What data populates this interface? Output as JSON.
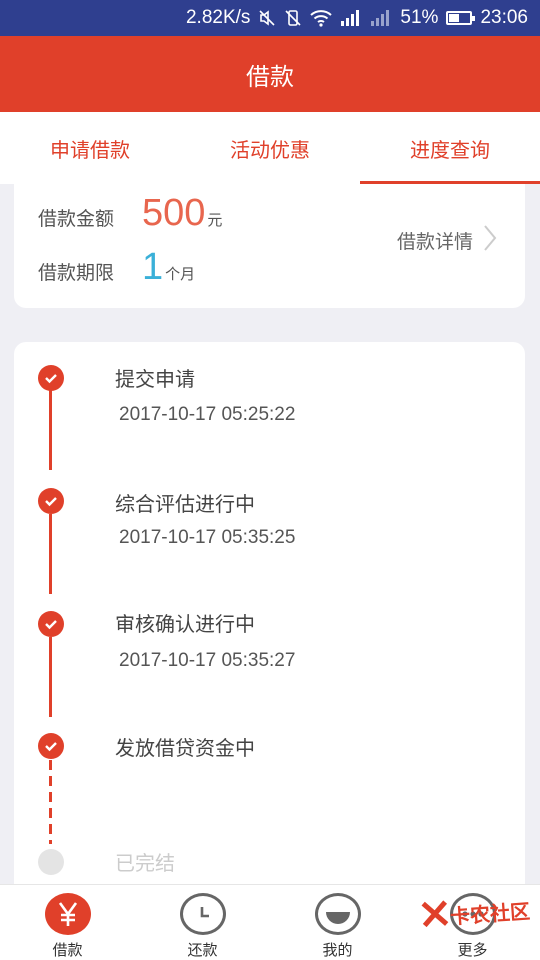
{
  "status_bar": {
    "speed": "2.82K/s",
    "battery": "51%",
    "battery_level": 0.51,
    "time": "23:06"
  },
  "header": {
    "title": "借款"
  },
  "tabs": [
    {
      "label": "申请借款",
      "active": false
    },
    {
      "label": "活动优惠",
      "active": false
    },
    {
      "label": "进度查询",
      "active": true
    }
  ],
  "summary": {
    "amount_label": "借款金额",
    "amount_value": "500",
    "amount_unit": "元",
    "term_label": "借款期限",
    "term_value": "1",
    "term_unit": "个月",
    "detail_link": "借款详情"
  },
  "timeline": {
    "steps": [
      {
        "title": "提交申请",
        "time": "2017-10-17 05:25:22",
        "status": "done"
      },
      {
        "title": "综合评估进行中",
        "time": "2017-10-17 05:35:25",
        "status": "done"
      },
      {
        "title": "审核确认进行中",
        "time": "2017-10-17 05:35:27",
        "status": "done"
      },
      {
        "title": "发放借贷资金中",
        "time": "",
        "status": "done"
      },
      {
        "title": "已完结",
        "time": "",
        "status": "pending"
      }
    ]
  },
  "bottom_nav": [
    {
      "label": "借款",
      "icon": "yen-icon",
      "active": true
    },
    {
      "label": "还款",
      "icon": "clock-icon",
      "active": false
    },
    {
      "label": "我的",
      "icon": "user-icon",
      "active": false
    },
    {
      "label": "更多",
      "icon": "more-icon",
      "active": false
    }
  ],
  "watermark": {
    "text": "卡农社区"
  },
  "colors": {
    "brand": "#e0402a",
    "status_bar": "#2f3f8f",
    "term": "#3ab0d8",
    "amount": "#e8664e"
  }
}
